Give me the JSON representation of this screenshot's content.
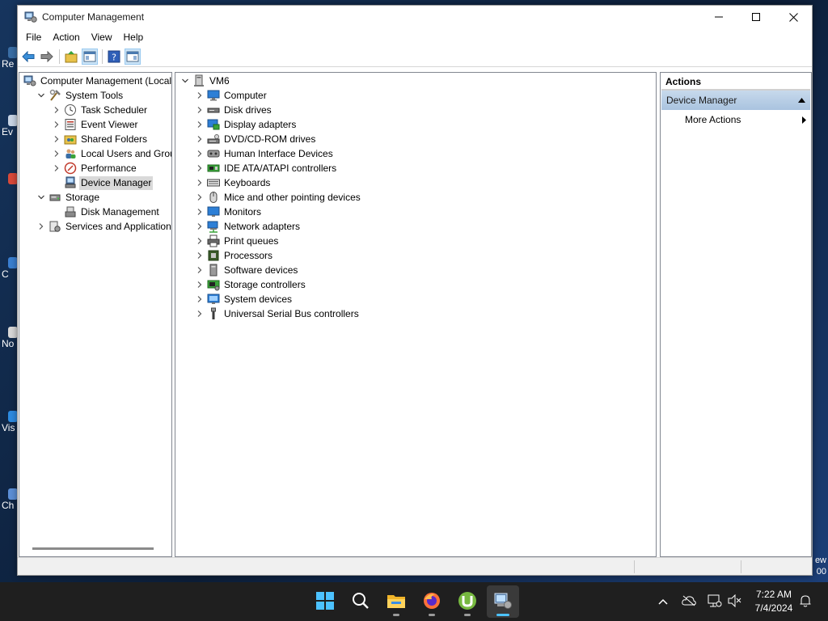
{
  "desktop": {
    "icons": [
      {
        "label": "Re",
        "color": "#3a6ea5"
      },
      {
        "label": "Ev",
        "color": "#c9d6e6"
      },
      {
        "label": "",
        "color": "#d94a3a"
      },
      {
        "label": "C",
        "color": "#3a7fd0"
      },
      {
        "label": "No",
        "color": "#d8d8d8"
      },
      {
        "label": "Vis",
        "color": "#2d8ae0"
      },
      {
        "label": "Ch",
        "color": "#5c8fd6"
      }
    ],
    "right_text_1": "ew",
    "right_text_2": "00"
  },
  "window": {
    "title": "Computer Management",
    "controls": {
      "minimize": "minimize",
      "maximize": "maximize",
      "close": "close"
    }
  },
  "menu": [
    "File",
    "Action",
    "View",
    "Help"
  ],
  "toolbar": [
    {
      "name": "back-icon"
    },
    {
      "name": "forward-icon"
    },
    {
      "name": "up-folder-icon"
    },
    {
      "name": "show-hide-console-tree-icon"
    },
    {
      "name": "help-icon"
    },
    {
      "name": "show-hide-action-pane-icon"
    }
  ],
  "tree": [
    {
      "label": "Computer Management (Local",
      "icon": "computer-management-icon",
      "level": 0,
      "expander": "none"
    },
    {
      "label": "System Tools",
      "icon": "system-tools-icon",
      "level": 1,
      "expander": "open"
    },
    {
      "label": "Task Scheduler",
      "icon": "task-scheduler-icon",
      "level": 2,
      "expander": "closed"
    },
    {
      "label": "Event Viewer",
      "icon": "event-viewer-icon",
      "level": 2,
      "expander": "closed"
    },
    {
      "label": "Shared Folders",
      "icon": "shared-folders-icon",
      "level": 2,
      "expander": "closed"
    },
    {
      "label": "Local Users and Groups",
      "icon": "local-users-icon",
      "level": 2,
      "expander": "closed"
    },
    {
      "label": "Performance",
      "icon": "performance-icon",
      "level": 2,
      "expander": "closed"
    },
    {
      "label": "Device Manager",
      "icon": "device-manager-icon",
      "level": 2,
      "expander": "none",
      "selected": true
    },
    {
      "label": "Storage",
      "icon": "storage-icon",
      "level": 1,
      "expander": "open"
    },
    {
      "label": "Disk Management",
      "icon": "disk-management-icon",
      "level": 2,
      "expander": "none"
    },
    {
      "label": "Services and Applications",
      "icon": "services-applications-icon",
      "level": 1,
      "expander": "closed"
    }
  ],
  "devices": {
    "root": "VM6",
    "categories": [
      {
        "label": "Computer",
        "icon": "computer-icon"
      },
      {
        "label": "Disk drives",
        "icon": "disk-drive-icon"
      },
      {
        "label": "Display adapters",
        "icon": "display-adapter-icon"
      },
      {
        "label": "DVD/CD-ROM drives",
        "icon": "dvd-drive-icon"
      },
      {
        "label": "Human Interface Devices",
        "icon": "hid-icon"
      },
      {
        "label": "IDE ATA/ATAPI controllers",
        "icon": "ide-controller-icon"
      },
      {
        "label": "Keyboards",
        "icon": "keyboard-icon"
      },
      {
        "label": "Mice and other pointing devices",
        "icon": "mouse-icon"
      },
      {
        "label": "Monitors",
        "icon": "monitor-icon"
      },
      {
        "label": "Network adapters",
        "icon": "network-adapter-icon"
      },
      {
        "label": "Print queues",
        "icon": "printer-icon"
      },
      {
        "label": "Processors",
        "icon": "processor-icon"
      },
      {
        "label": "Software devices",
        "icon": "software-device-icon"
      },
      {
        "label": "Storage controllers",
        "icon": "storage-controller-icon"
      },
      {
        "label": "System devices",
        "icon": "system-device-icon"
      },
      {
        "label": "Universal Serial Bus controllers",
        "icon": "usb-icon"
      }
    ]
  },
  "actions": {
    "header": "Actions",
    "section": "Device Manager",
    "items": [
      "More Actions"
    ]
  },
  "taskbar": {
    "apps": [
      {
        "name": "start-button",
        "icon": "windows-logo-icon"
      },
      {
        "name": "search-button",
        "icon": "search-icon"
      },
      {
        "name": "file-explorer-button",
        "icon": "folder-icon"
      },
      {
        "name": "firefox-button",
        "icon": "firefox-icon"
      },
      {
        "name": "utorrent-button",
        "icon": "utorrent-icon"
      },
      {
        "name": "computer-management-button",
        "icon": "computer-management-icon"
      }
    ],
    "tray": [
      "chevron-up-icon",
      "cloud-offline-icon",
      "network-icon",
      "volume-muted-icon"
    ],
    "time": "7:22 AM",
    "date": "7/4/2024",
    "notification_icon": "bell-icon"
  },
  "colors": {
    "selection": "#d9d9d9",
    "actions_section": "#b9cfe6",
    "taskbar": "#1f1f1f",
    "accent": "#4cc2ff"
  }
}
